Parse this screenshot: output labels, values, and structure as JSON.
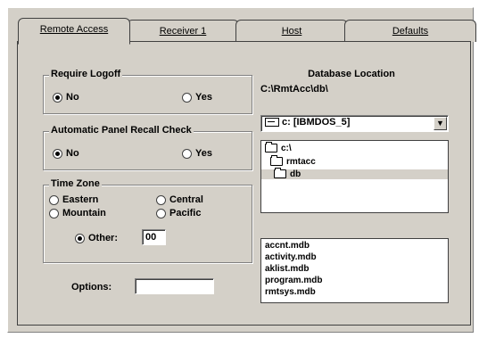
{
  "tabs": [
    {
      "label": "Remote Access",
      "active": true
    },
    {
      "label": "Receiver 1",
      "active": false
    },
    {
      "label": "Host",
      "active": false
    },
    {
      "label": "Defaults",
      "active": false
    }
  ],
  "require_logoff": {
    "title": "Require Logoff",
    "options": [
      {
        "label": "No",
        "selected": true
      },
      {
        "label": "Yes",
        "selected": false
      }
    ]
  },
  "auto_panel_recall": {
    "title": "Automatic Panel Recall Check",
    "options": [
      {
        "label": "No",
        "selected": true
      },
      {
        "label": "Yes",
        "selected": false
      }
    ]
  },
  "time_zone": {
    "title": "Time Zone",
    "options": [
      {
        "label": "Eastern",
        "selected": false
      },
      {
        "label": "Central",
        "selected": false
      },
      {
        "label": "Mountain",
        "selected": false
      },
      {
        "label": "Pacific",
        "selected": false
      },
      {
        "label": "Other:",
        "selected": true
      }
    ],
    "other_value": "00"
  },
  "options": {
    "label": "Options:",
    "value": ""
  },
  "database": {
    "title": "Database Location",
    "path": "C:\\RmtAcc\\db\\",
    "drive": "c: [IBMDOS_5]",
    "folders": [
      "c:\\",
      "rmtacc",
      "db"
    ],
    "files": [
      "accnt.mdb",
      "activity.mdb",
      "aklist.mdb",
      "program.mdb",
      "rmtsys.mdb"
    ]
  },
  "icons": {
    "drive": "drive-icon",
    "folder": "folder-icon",
    "dropdown": "dropdown-arrow-icon"
  }
}
